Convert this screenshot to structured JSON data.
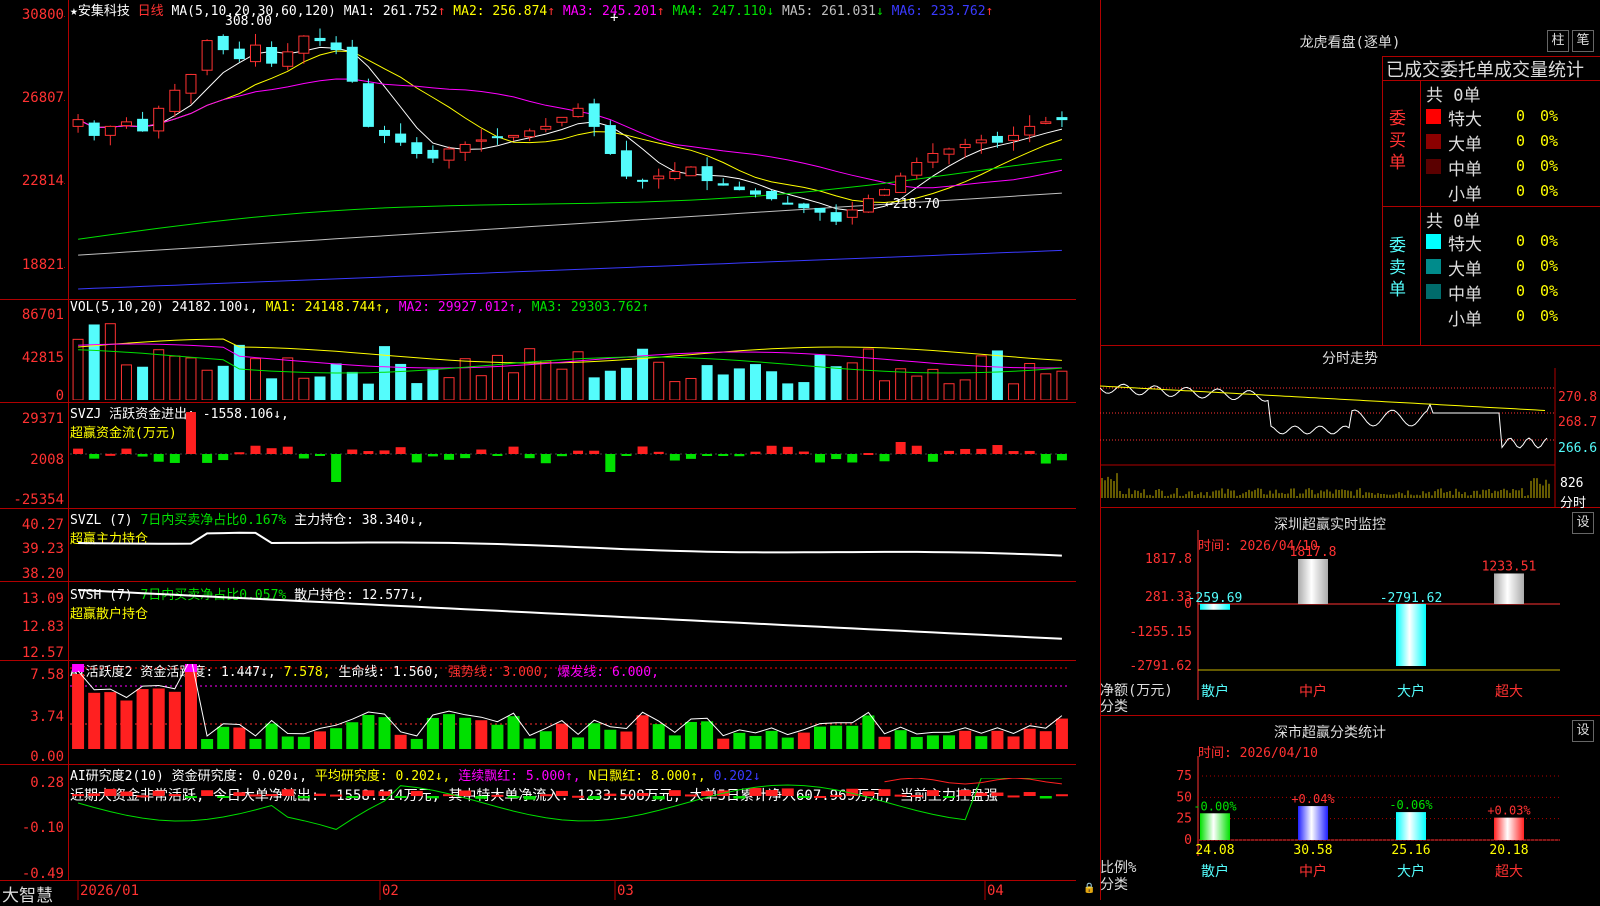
{
  "stock": {
    "star": "★",
    "name": "安集科技",
    "period": "日线"
  },
  "main_chart": {
    "ma_label": "MA(5,10,20,30,60,120)",
    "ma_values": [
      {
        "label": "MA1: 261.752",
        "arrow": "↑",
        "color": "#ffffff"
      },
      {
        "label": "MA2: 256.874",
        "arrow": "↑",
        "color": "#ffff00"
      },
      {
        "label": "MA3: 245.201",
        "arrow": "↑",
        "color": "#ff00ff"
      },
      {
        "label": "MA4: 247.110",
        "arrow": "↓",
        "color": "#00e000"
      },
      {
        "label": "MA5: 261.031",
        "arrow": "↓",
        "color": "#c0c0c0"
      },
      {
        "label": "MA6: 233.762",
        "arrow": "↑",
        "color": "#3a3aff"
      }
    ],
    "y_ticks": [
      "30800",
      "26807",
      "22814",
      "18821"
    ],
    "high_marker": "308.00",
    "low_marker": "←218.70"
  },
  "vol_panel": {
    "label": "VOL(5,10,20)",
    "value": "24182.100↓,",
    "ma1": "MA1: 24148.744↑,",
    "ma2": "MA2: 29927.012↑,",
    "ma3": "MA3: 29303.762↑",
    "y_ticks": [
      "86701",
      "42815",
      "0"
    ]
  },
  "svzj_panel": {
    "line1": "SVZJ  活跃资金进出: -1558.106↓,",
    "line2": "超赢资金流(万元)",
    "y_ticks": [
      "29371",
      "2008",
      "-25354"
    ]
  },
  "svzl_panel": {
    "label": "SVZL (7)",
    "text1": "7日内买卖净占比0.167%",
    "text2": "主力持仓: 38.340↓,",
    "line2": "超赢主力持仓",
    "y_ticks": [
      "40.27",
      "39.23",
      "38.20"
    ]
  },
  "svsh_panel": {
    "label": "SVSH (7)",
    "text1": "7日内买卖净占比0.057%",
    "text2": "散户持仓: 12.577↓,",
    "line2": "超赢散户持仓",
    "y_ticks": [
      "13.09",
      "12.83",
      "12.57"
    ]
  },
  "ai_active_panel": {
    "label": "AI活跃度2",
    "t1": "资金活跃度: 1.447↓,",
    "t2": "7.578,",
    "t3": "生命线: 1.560,",
    "t4": "强势线: 3.000,",
    "t5": "爆发线: 6.000,",
    "y_ticks": [
      "7.58",
      "3.74",
      "0.00"
    ]
  },
  "ai_research_panel": {
    "label": "AI研究度2(10)",
    "t1": "资金研究度: 0.020↓,",
    "t2": "平均研究度: 0.202↓,",
    "t3": "连续飘红: 5.000↑,",
    "t4": "N日飘红: 8.000↑,",
    "t5": "0.202↓",
    "summary": "近期大资金非常活跃, 今日大单净流出: -1558.114万元, 其中特大单净流入: 1233.508万元, 大单5日累计净入607.969万元, 当前主力控盘强",
    "y_ticks": [
      "0.28",
      "-0.10",
      "-0.49"
    ]
  },
  "x_axis": {
    "brand": "大智慧",
    "labels": [
      "2026/01",
      "02",
      "03",
      "04"
    ]
  },
  "lhkp": {
    "title": "龙虎看盘(逐单)",
    "btn_bar": "柱",
    "btn_pen": "笔",
    "tabs": "已成交委托单成交量统计",
    "buy": {
      "side_label": "委买单",
      "total": "共 0单",
      "rows": [
        {
          "label": "特大",
          "count": "0",
          "pct": "0%",
          "color": "#ff0000"
        },
        {
          "label": "大单",
          "count": "0",
          "pct": "0%",
          "color": "#8b0000"
        },
        {
          "label": "中单",
          "count": "0",
          "pct": "0%",
          "color": "#5a0000"
        },
        {
          "label": "小单",
          "count": "0",
          "pct": "0%",
          "color": ""
        }
      ]
    },
    "sell": {
      "side_label": "委卖单",
      "total": "共 0单",
      "rows": [
        {
          "label": "特大",
          "count": "0",
          "pct": "0%",
          "color": "#00ffff"
        },
        {
          "label": "大单",
          "count": "0",
          "pct": "0%",
          "color": "#008b8b"
        },
        {
          "label": "中单",
          "count": "0",
          "pct": "0%",
          "color": "#006b6b"
        },
        {
          "label": "小单",
          "count": "0",
          "pct": "0%",
          "color": ""
        }
      ]
    }
  },
  "intraday": {
    "title": "分时走势",
    "y_ticks": [
      "270.8",
      "268.7",
      "266.6"
    ],
    "vol_tick": "826",
    "vol_label": "分时"
  },
  "monitor": {
    "title": "深圳超赢实时监控",
    "btn": "设",
    "time": "时间: 2026/04/10",
    "y_ticks": [
      "1817.8",
      "281.33",
      "0",
      "-1255.15",
      "-2791.62"
    ],
    "bars": [
      {
        "cat": "散户",
        "value": -259.69,
        "label": "-259.69"
      },
      {
        "cat": "中户",
        "value": 1817.8,
        "label": "1817.8"
      },
      {
        "cat": "大户",
        "value": -2791.62,
        "label": "-2791.62"
      },
      {
        "cat": "超大",
        "value": 1233.51,
        "label": "1233.51"
      }
    ],
    "ylabel1": "净额(万元)",
    "ylabel2": "分类"
  },
  "classify": {
    "title": "深市超赢分类统计",
    "btn": "设",
    "time": "时间: 2026/04/10",
    "y_ticks": [
      "75",
      "50",
      "25",
      "0"
    ],
    "bars": [
      {
        "cat": "散户",
        "value": 24.08,
        "change": "-0.00%",
        "color": "#00e000"
      },
      {
        "cat": "中户",
        "value": 30.58,
        "change": "+0.04%",
        "color": "#2020ff"
      },
      {
        "cat": "大户",
        "value": 25.16,
        "change": "-0.06%",
        "color": "#00ffff"
      },
      {
        "cat": "超大",
        "value": 20.18,
        "change": "+0.03%",
        "color": "#ff2020"
      }
    ],
    "ylabel1": "比例%",
    "ylabel2": "分类"
  }
}
